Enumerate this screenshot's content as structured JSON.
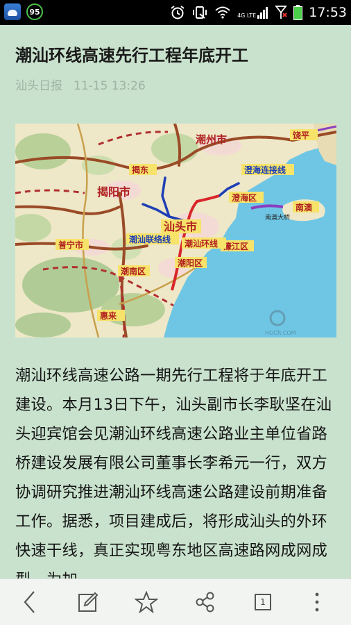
{
  "status_bar": {
    "badge_value": "95",
    "network_label": "4G LTE",
    "time": "17:53"
  },
  "article": {
    "title": "潮汕环线高速先行工程年底开工",
    "source": "汕头日报",
    "datetime": "11-15 13:26",
    "body": "潮汕环线高速公路一期先行工程将于年底开工建设。本月13日下午，汕头副市长李耿坚在汕头迎宾馆会见潮汕环线高速公路业主单位省路桥建设发展有限公司董事长李希元一行，双方协调研究推进潮汕环线高速公路建设前期准备工作。据悉，项目建成后，将形成汕头的外环快速干线，真正实现粤东地区高速路网成网成型。为加"
  },
  "map": {
    "labels": {
      "chaozhou": "潮州市",
      "jieyang": "揭阳市",
      "shantou": "汕头市",
      "puning": "普宁市",
      "chaonan": "潮南区",
      "chaoyang": "潮阳区",
      "haojiang": "濠江区",
      "chenghai": "澄海区",
      "nanao": "南澳",
      "huilai": "惠来",
      "jiedong": "揭东",
      "raoping": "饶平",
      "chenghai_link": "澄海连接线",
      "chaoshan_link": "潮汕联络线",
      "chaoshan_ring": "潮汕环线",
      "nanao_bridge": "南澳大桥",
      "watermark": "HOCR.COM"
    },
    "colors": {
      "sea": "#6fc6e4",
      "land": "#eee7c8",
      "ring_red": "#d8262a",
      "link_blue": "#1d3fb5",
      "bridge_purple": "#8b3fc0",
      "highway_brown": "#9a4b26"
    }
  },
  "toolbar": {
    "page_count": "1"
  }
}
